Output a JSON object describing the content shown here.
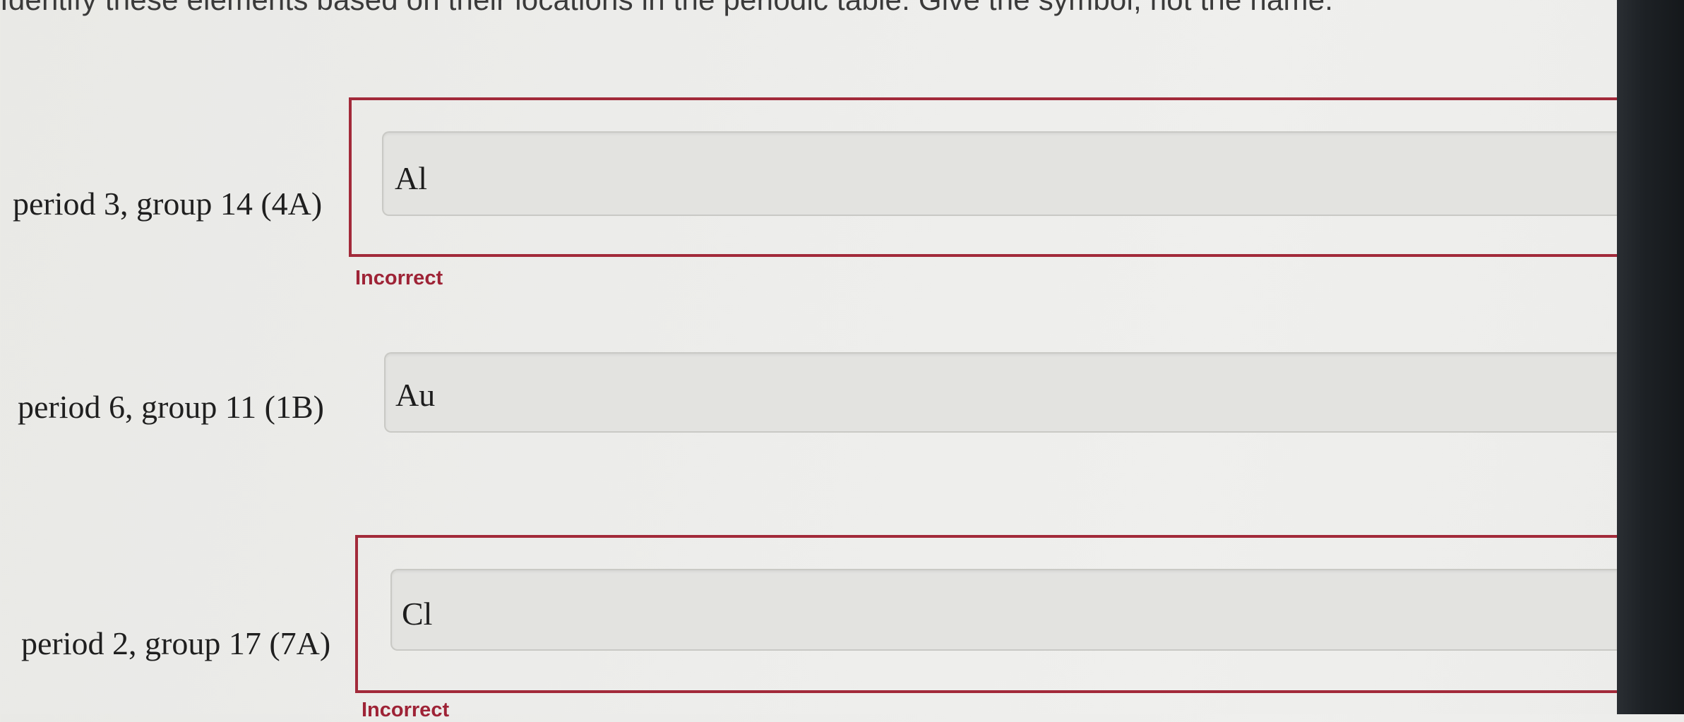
{
  "instruction": "Identify these elements based on their locations in the periodic table. Give the symbol, not the name.",
  "questions": [
    {
      "label": "period 3, group 14 (4A)",
      "answer": "Al",
      "feedback": "Incorrect"
    },
    {
      "label": "period 6, group 11 (1B)",
      "answer": "Au",
      "feedback": ""
    },
    {
      "label": "period 2, group 17 (7A)",
      "answer": "Cl",
      "feedback": "Incorrect"
    }
  ],
  "colors": {
    "error": "#a22a3a",
    "background": "#ededeb",
    "bezel": "#1d2125"
  }
}
